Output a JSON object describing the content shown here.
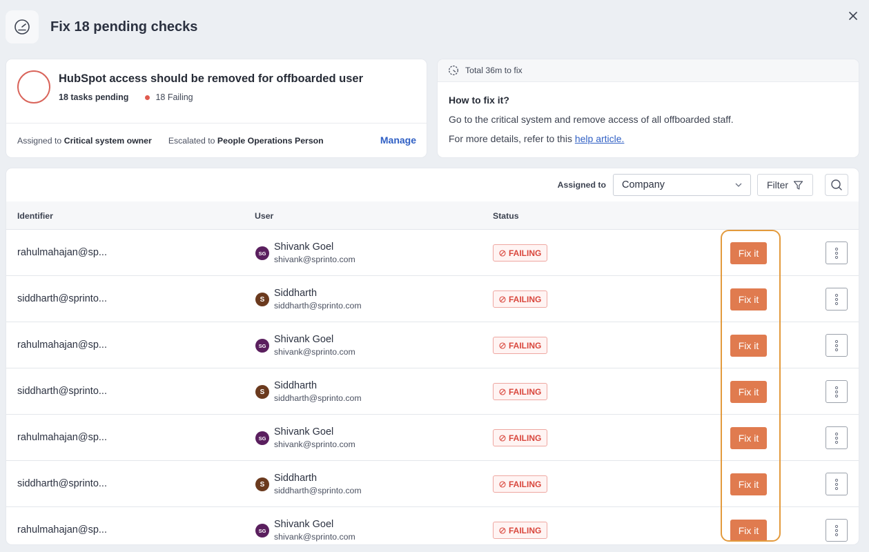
{
  "header": {
    "title": "Fix 18 pending checks"
  },
  "check": {
    "title": "HubSpot access should be removed for offboarded user",
    "pending": "18 tasks pending",
    "failing": "18 Failing",
    "assigned_prefix": "Assigned to",
    "assigned_value": "Critical system owner",
    "escalated_prefix": "Escalated to",
    "escalated_value": "People Operations Person",
    "manage_label": "Manage"
  },
  "fix": {
    "total_time": "Total 36m to fix",
    "question": "How to fix it?",
    "line1": "Go to the critical system and remove access of all offboarded staff.",
    "line2_prefix": "For more details, refer to this",
    "link_label": "help article."
  },
  "toolbar": {
    "assigned_label": "Assigned to",
    "selected": "Company",
    "filter_label": "Filter"
  },
  "table": {
    "columns": [
      "Identifier",
      "User",
      "Status"
    ],
    "rows": [
      {
        "identifier": "rahulmahajan@sp...",
        "initials": "SG",
        "name": "Shivank Goel",
        "email": "shivank@sprinto.com",
        "status": "FAILING",
        "action": "Fix it"
      },
      {
        "identifier": "siddharth@sprinto...",
        "initials": "S",
        "name": "Siddharth",
        "email": "siddharth@sprinto.com",
        "status": "FAILING",
        "action": "Fix it"
      },
      {
        "identifier": "rahulmahajan@sp...",
        "initials": "SG",
        "name": "Shivank Goel",
        "email": "shivank@sprinto.com",
        "status": "FAILING",
        "action": "Fix it"
      },
      {
        "identifier": "siddharth@sprinto...",
        "initials": "S",
        "name": "Siddharth",
        "email": "siddharth@sprinto.com",
        "status": "FAILING",
        "action": "Fix it"
      },
      {
        "identifier": "rahulmahajan@sp...",
        "initials": "SG",
        "name": "Shivank Goel",
        "email": "shivank@sprinto.com",
        "status": "FAILING",
        "action": "Fix it"
      },
      {
        "identifier": "siddharth@sprinto...",
        "initials": "S",
        "name": "Siddharth",
        "email": "siddharth@sprinto.com",
        "status": "FAILING",
        "action": "Fix it"
      },
      {
        "identifier": "rahulmahajan@sp...",
        "initials": "SG",
        "name": "Shivank Goel",
        "email": "shivank@sprinto.com",
        "status": "FAILING",
        "action": "Fix it"
      }
    ]
  },
  "colors": {
    "accent_orange": "#e07b4f",
    "failing_red": "#d9473d",
    "link_blue": "#2f5fc4",
    "highlight": "#e39a3c",
    "avatar_sg": "#5a1f5e",
    "avatar_s": "#6b3a1e"
  }
}
